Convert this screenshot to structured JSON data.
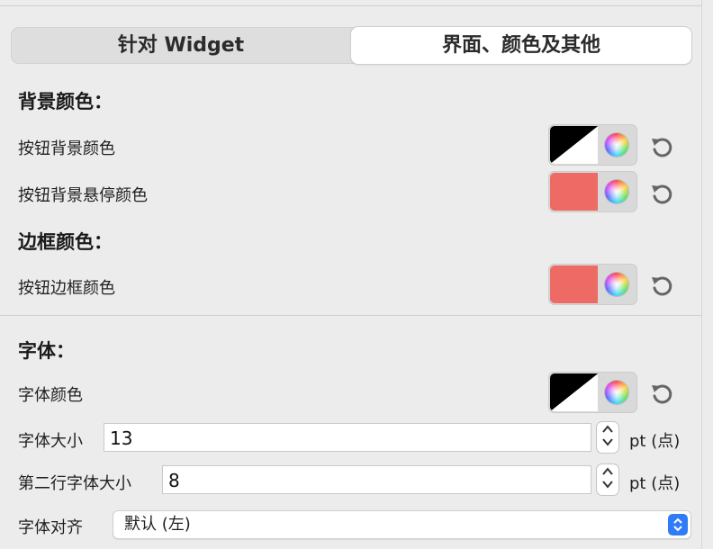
{
  "tabs": {
    "widget": "针对 Widget",
    "interface": "界面、颜色及其他",
    "selected": "interface"
  },
  "sections": {
    "background": {
      "heading": "背景颜色：",
      "button_bg_label": "按钮背景颜色",
      "button_bg_hover_label": "按钮背景悬停颜色"
    },
    "border": {
      "heading": "边框颜色：",
      "button_border_label": "按钮边框颜色"
    },
    "font": {
      "heading": "字体：",
      "font_color_label": "字体颜色",
      "font_size_label": "字体大小",
      "font_size_value": "13",
      "second_line_size_label": "第二行字体大小",
      "second_line_size_value": "8",
      "unit": "pt (点)",
      "align_label": "字体对齐",
      "align_value": "默认 (左)"
    }
  },
  "colors": {
    "button_bg": "black/white default",
    "button_bg_hover": "#ee6a64",
    "button_border": "#ee6a64",
    "font_color": "black/white default",
    "accent": "#2f7cf6"
  },
  "icons": {
    "color_picker": "color-wheel-icon",
    "reset": "reset-icon",
    "stepper": "stepper-arrows-icon",
    "popup": "popup-chevrons-icon"
  }
}
